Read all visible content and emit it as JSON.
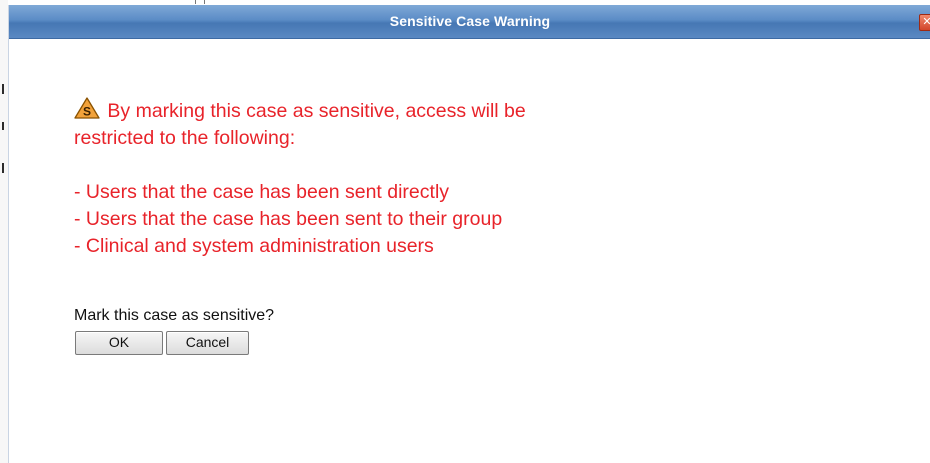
{
  "dialog": {
    "title": "Sensitive Case Warning",
    "close_glyph": "✕"
  },
  "warning": {
    "icon": "warning-triangle-s-icon",
    "icon_letter": "S",
    "line1": "By marking this case as sensitive, access will be",
    "line2": "restricted to the following:",
    "items": [
      "- Users that the case has been sent directly",
      "- Users that the case has been sent to their group",
      "- Clinical and system administration users"
    ]
  },
  "prompt": "Mark this case as sensitive?",
  "buttons": {
    "ok": "OK",
    "cancel": "Cancel"
  },
  "colors": {
    "warning_text": "#e8232a",
    "titlebar": "#5b8cc6",
    "icon_fill": "#f2a23a"
  }
}
